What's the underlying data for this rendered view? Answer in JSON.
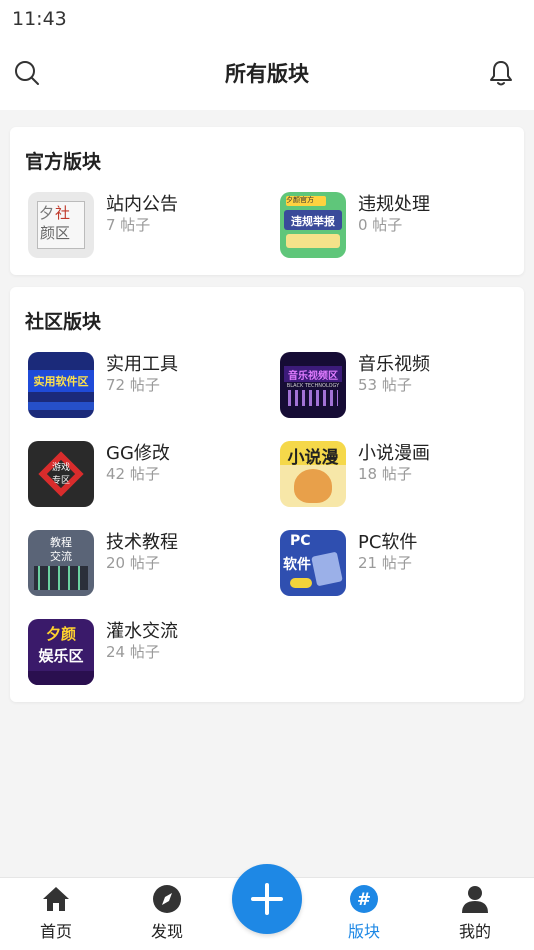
{
  "status_bar": {
    "time": "11:43"
  },
  "header": {
    "title": "所有版块",
    "search_icon": "search-icon",
    "bell_icon": "bell-icon"
  },
  "official": {
    "title": "官方版块",
    "forums": [
      {
        "name": "站内公告",
        "count": "7 帖子",
        "thumb_text_1": "夕",
        "thumb_text_2": "社",
        "thumb_text_3": "颜区"
      },
      {
        "name": "违规处理",
        "count": "0 帖子",
        "thumb_text_1": "夕颜官方",
        "thumb_text_2": "违规举报"
      }
    ]
  },
  "community": {
    "title": "社区版块",
    "forums": [
      {
        "name": "实用工具",
        "count": "72 帖子",
        "thumb_text_1": "实用软件区"
      },
      {
        "name": "音乐视频",
        "count": "53 帖子",
        "thumb_text_1": "音乐视频区",
        "thumb_text_2": "BLACK TECHNOLOGY"
      },
      {
        "name": "GG修改",
        "count": "42 帖子",
        "thumb_text_1": "游戏",
        "thumb_text_2": "专区"
      },
      {
        "name": "小说漫画",
        "count": "18 帖子",
        "thumb_text_1": "小说漫"
      },
      {
        "name": "技术教程",
        "count": "20 帖子",
        "thumb_text_1": "教程",
        "thumb_text_2": "交流"
      },
      {
        "name": "PC软件",
        "count": "21 帖子",
        "thumb_text_1": "PC",
        "thumb_text_2": "软件"
      },
      {
        "name": "灌水交流",
        "count": "24 帖子",
        "thumb_text_1": "夕颜",
        "thumb_text_2": "娱乐区"
      }
    ]
  },
  "bottom_nav": {
    "items": [
      {
        "label": "首页",
        "icon": "home-icon"
      },
      {
        "label": "发现",
        "icon": "compass-icon"
      },
      {
        "label": "版块",
        "icon": "hash-icon",
        "active": true
      },
      {
        "label": "我的",
        "icon": "user-icon"
      }
    ],
    "fab_icon": "plus-icon"
  },
  "colors": {
    "accent": "#1e88e5",
    "background": "#f4f4f4",
    "muted_text": "#9a9a9a"
  }
}
